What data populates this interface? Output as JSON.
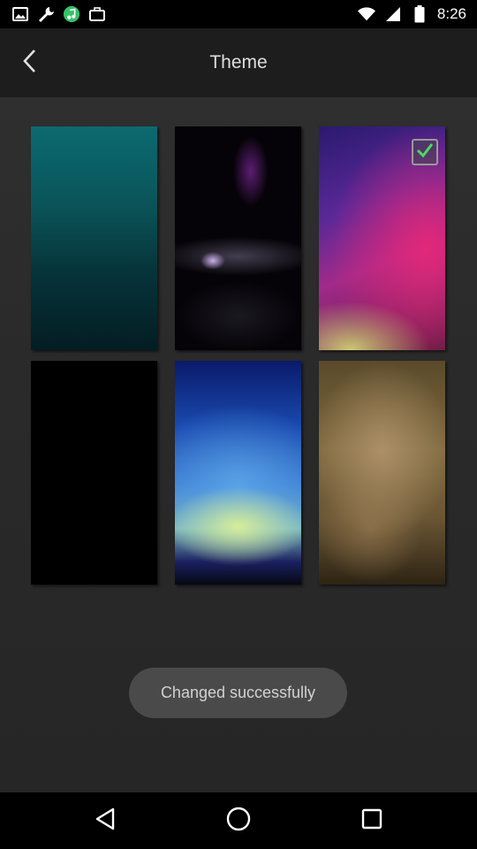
{
  "status_bar": {
    "time": "8:26",
    "left_icons": [
      "image-icon",
      "wrench-icon",
      "music-icon",
      "briefcase-icon"
    ],
    "right_icons": [
      "wifi-icon",
      "signal-icon",
      "battery-icon"
    ]
  },
  "header": {
    "title": "Theme",
    "back_icon": "chevron-left-icon"
  },
  "themes": [
    {
      "name": "teal"
    },
    {
      "name": "dark-purple-smoke"
    },
    {
      "name": "purple-pink",
      "selected": true
    },
    {
      "name": "black"
    },
    {
      "name": "aurora-blue"
    },
    {
      "name": "brown-texture"
    }
  ],
  "toast": {
    "text": "Changed successfully"
  },
  "nav_bar": {
    "icons": [
      "back-triangle-icon",
      "home-circle-icon",
      "recent-square-icon"
    ]
  },
  "colors": {
    "check_accent": "#4cd964",
    "header_bg": "#1d1d1d",
    "content_bg": "#2b2b2b"
  }
}
